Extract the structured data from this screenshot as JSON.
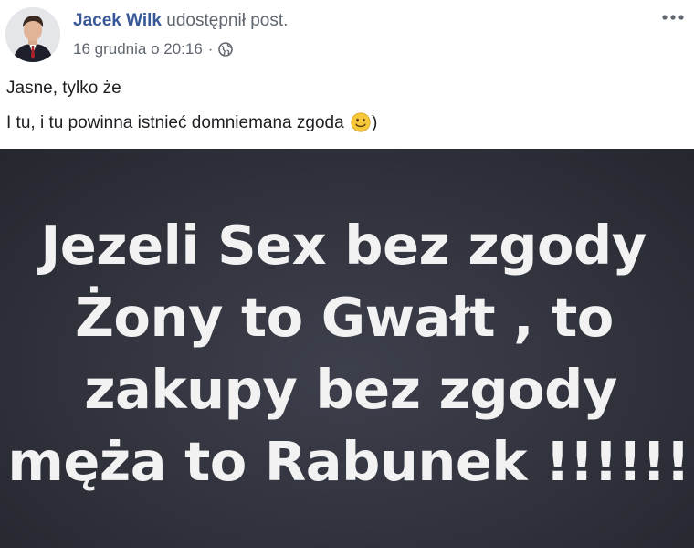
{
  "post": {
    "author_name": "Jacek Wilk",
    "action_text": "udostępnił post.",
    "timestamp": "16 grudnia o 20:16",
    "separator": "·",
    "privacy_icon": "globe-icon",
    "more_icon": "ellipsis-icon",
    "text_line_1": "Jasne, tylko że",
    "text_line_2_before": "I tu, i tu powinna istnieć domniemana zgoda",
    "text_line_2_emoji": "slightly-smiling-face-icon",
    "text_line_2_after": ")"
  },
  "image": {
    "lines": [
      "Jezeli Sex bez zgody",
      "Żony to Gwałt , to",
      "zakupy bez zgody",
      "męża to Rabunek !!!!!!"
    ]
  },
  "colors": {
    "author_link": "#385898",
    "secondary_text": "#606770",
    "body_text": "#1c1e21",
    "image_background": "#30323c",
    "image_text": "#f2f2f2",
    "emoji_face": "#f7c93a"
  }
}
